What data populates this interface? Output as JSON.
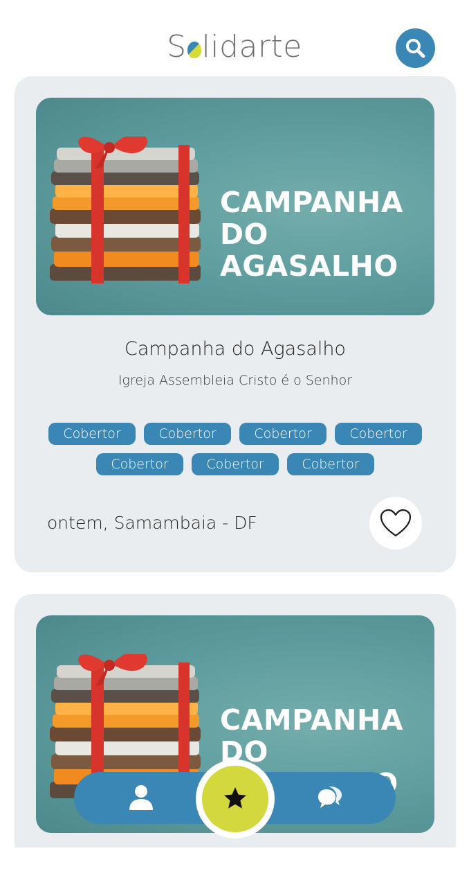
{
  "app": {
    "logo_prefix": "S",
    "logo_suffix": "lidarte",
    "logo_colors": {
      "blue": "#3a86b5",
      "yellow": "#d7db3a",
      "text": "#6f6f6f"
    },
    "search_icon": "search-icon"
  },
  "colors": {
    "accent": "#3a86b5",
    "card_bg": "#e9edf0",
    "center_button": "#d3d83c"
  },
  "cards": [
    {
      "banner_line1": "CAMPANHA",
      "banner_line2": "DO AGASALHO",
      "title": "Campanha do Agasalho",
      "subtitle": "Igreja Assembleia Cristo é o Senhor",
      "tags": [
        "Cobertor",
        "Cobertor",
        "Cobertor",
        "Cobertor",
        "Cobertor",
        "Cobertor",
        "Cobertor"
      ],
      "footer": "ontem, Samambaia - DF",
      "favorite_icon": "heart-outline-icon"
    },
    {
      "banner_line1": "CAMPANHA",
      "banner_line2": "DO AGASALHO"
    }
  ],
  "nav": {
    "items": [
      {
        "icon": "user-icon"
      },
      {
        "icon": "star-icon"
      },
      {
        "icon": "chat-bubbles-icon"
      }
    ]
  }
}
